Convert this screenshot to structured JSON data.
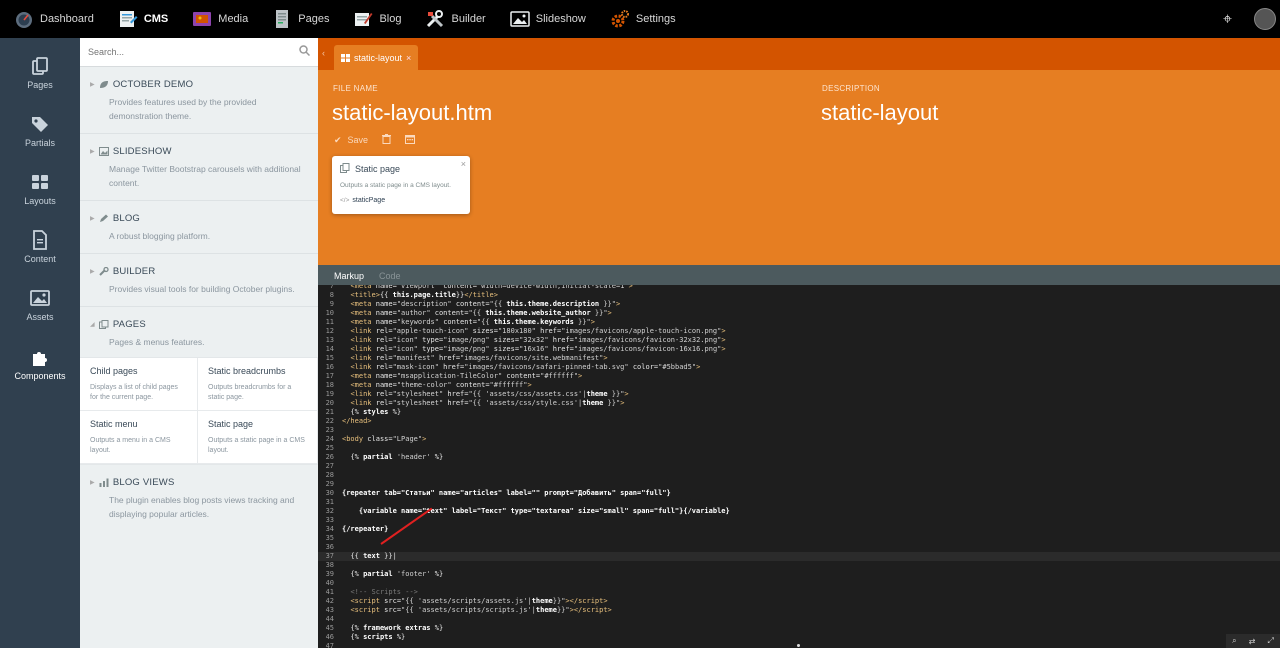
{
  "topbar": {
    "items": [
      {
        "label": "Dashboard",
        "icon": "dashboard-icon"
      },
      {
        "label": "CMS",
        "icon": "cms-icon",
        "active": true
      },
      {
        "label": "Media",
        "icon": "media-icon"
      },
      {
        "label": "Pages",
        "icon": "pages-icon"
      },
      {
        "label": "Blog",
        "icon": "blog-icon"
      },
      {
        "label": "Builder",
        "icon": "builder-icon"
      },
      {
        "label": "Slideshow",
        "icon": "slideshow-icon"
      },
      {
        "label": "Settings",
        "icon": "settings-icon"
      }
    ]
  },
  "leftnav": {
    "items": [
      {
        "label": "Pages",
        "icon": "pages-icon"
      },
      {
        "label": "Partials",
        "icon": "tags-icon"
      },
      {
        "label": "Layouts",
        "icon": "layouts-icon"
      },
      {
        "label": "Content",
        "icon": "content-icon"
      },
      {
        "label": "Assets",
        "icon": "image-icon"
      },
      {
        "label": "Components",
        "icon": "puzzle-icon",
        "active": true
      }
    ]
  },
  "sidepanel": {
    "search_placeholder": "Search...",
    "plugins": [
      {
        "name": "OCTOBER DEMO",
        "desc": "Provides features used by the provided demonstration theme."
      },
      {
        "name": "SLIDESHOW",
        "desc": "Manage Twitter Bootstrap carousels with additional content."
      },
      {
        "name": "BLOG",
        "desc": "A robust blogging platform."
      },
      {
        "name": "BUILDER",
        "desc": "Provides visual tools for building October plugins."
      },
      {
        "name": "PAGES",
        "desc": "Pages & menus features."
      },
      {
        "name": "BLOG VIEWS",
        "desc": "The plugin enables blog posts views tracking and displaying popular articles."
      }
    ],
    "components": [
      {
        "title": "Child pages",
        "desc": "Displays a list of child pages for the current page."
      },
      {
        "title": "Static breadcrumbs",
        "desc": "Outputs breadcrumbs for a static page."
      },
      {
        "title": "Static menu",
        "desc": "Outputs a menu in a CMS layout."
      },
      {
        "title": "Static page",
        "desc": "Outputs a static page in a CMS layout."
      }
    ]
  },
  "main": {
    "tab_label": "static-layout",
    "file_name_label": "FILE NAME",
    "file_name": "static-layout.htm",
    "description_label": "DESCRIPTION",
    "description": "static-layout",
    "save_label": "Save",
    "popup": {
      "title": "Static page",
      "desc": "Outputs a static page in a CMS layout.",
      "alias": "staticPage"
    },
    "section_tabs": [
      "Markup",
      "Code"
    ]
  },
  "colors": {
    "accent_orange": "#e67e22",
    "tab_orange": "#d35400",
    "sidebar_dark": "#30404f",
    "panel_light": "#ecf0f1"
  }
}
